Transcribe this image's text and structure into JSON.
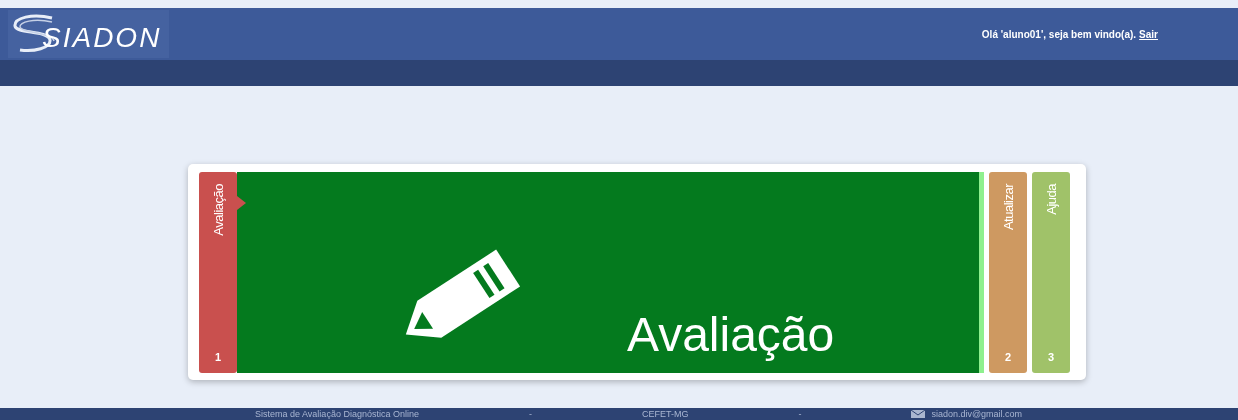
{
  "header": {
    "logo": "SIADON",
    "greeting": "Olá 'aluno01', seja bem vindo(a).",
    "logout_link": "Sair"
  },
  "tabs": [
    {
      "label": "Avaliação",
      "number": "1",
      "color": "#c9504e",
      "selected": true
    },
    {
      "label": "Atualizar",
      "number": "2",
      "color": "#c89157",
      "selected": false
    },
    {
      "label": "Ajuda",
      "number": "3",
      "color": "#98bb5f",
      "selected": false
    }
  ],
  "panel": {
    "title": "Avaliação"
  },
  "footer": {
    "items": [
      "Sistema de Avaliação Diagnóstica Online",
      "-",
      "CEFET-MG",
      "-",
      "siadon.div@gmail.com"
    ]
  }
}
